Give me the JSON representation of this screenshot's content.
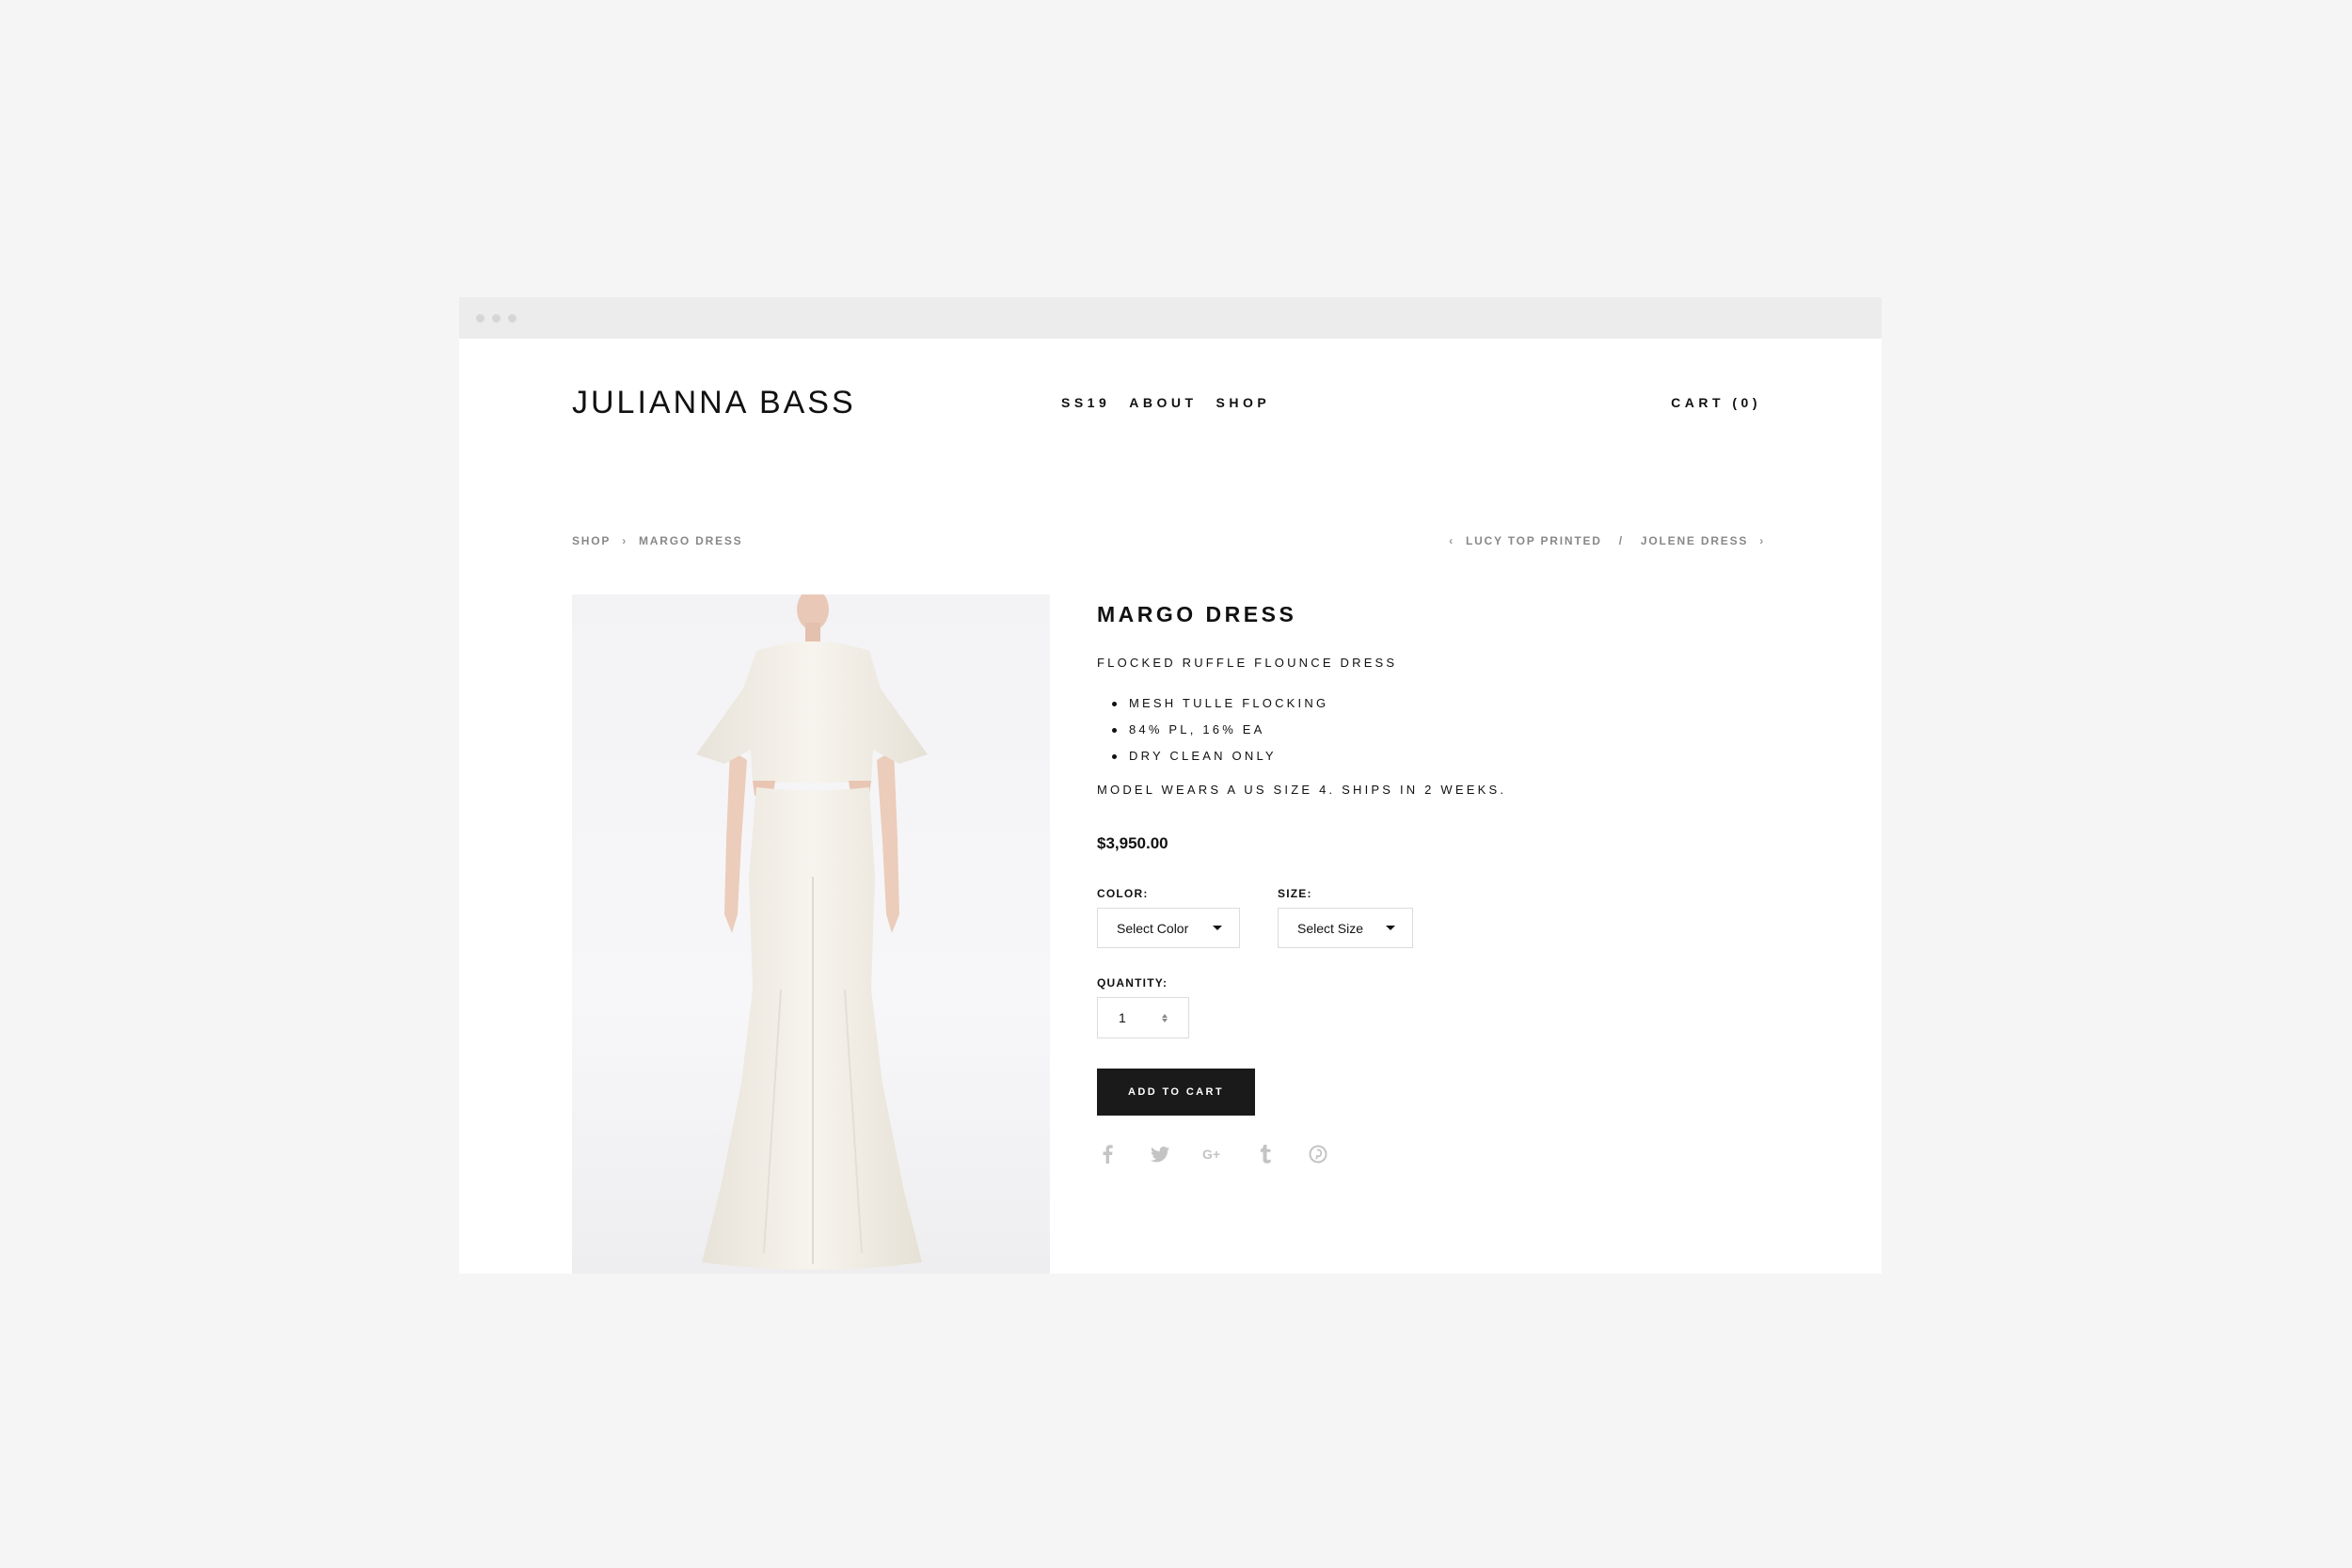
{
  "header": {
    "logo": "JULIANNA BASS",
    "nav": [
      "SS19",
      "ABOUT",
      "SHOP"
    ],
    "cart": "CART (0)"
  },
  "breadcrumb": {
    "items": [
      "SHOP",
      "MARGO DRESS"
    ],
    "separator": "›"
  },
  "pager": {
    "prev_arrow": "‹",
    "prev": "LUCY TOP PRINTED",
    "divider": "/",
    "next": "JOLENE DRESS",
    "next_arrow": "›"
  },
  "product": {
    "title": "MARGO DRESS",
    "subtitle": "FLOCKED RUFFLE FLOUNCE DRESS",
    "features": [
      "MESH TULLE FLOCKING",
      "84% PL, 16% EA",
      "DRY CLEAN ONLY"
    ],
    "shipping_note": "MODEL WEARS A US SIZE 4. SHIPS IN 2 WEEKS.",
    "price": "$3,950.00"
  },
  "options": {
    "color_label": "COLOR:",
    "color_value": "Select Color",
    "size_label": "SIZE:",
    "size_value": "Select Size",
    "quantity_label": "QUANTITY:",
    "quantity_value": "1"
  },
  "actions": {
    "add_to_cart": "ADD TO CART"
  },
  "share_icons": [
    "facebook-icon",
    "twitter-icon",
    "google-plus-icon",
    "tumblr-icon",
    "pinterest-icon"
  ],
  "colors": {
    "page_bg": "#f5f5f5",
    "button_bg": "#1a1a1a",
    "muted_text": "#888888",
    "icon_gray": "#c4c4c4"
  }
}
